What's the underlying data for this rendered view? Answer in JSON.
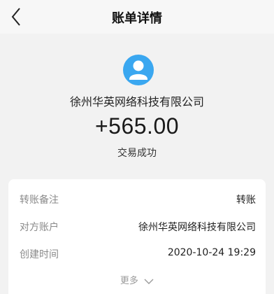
{
  "header": {
    "title": "账单详情"
  },
  "summary": {
    "avatar_icon": "user-avatar-icon",
    "payee_name": "徐州华英网络科技有限公司",
    "amount": "+565.00",
    "status": "交易成功"
  },
  "details": {
    "rows": [
      {
        "label": "转账备注",
        "value": "转账"
      },
      {
        "label": "对方账户",
        "value": "徐州华英网络科技有限公司"
      },
      {
        "label": "创建时间",
        "value": "2020-10-24 19:29"
      }
    ],
    "more_label": "更多"
  },
  "colors": {
    "avatar_bg": "#3aa7f0",
    "page_bg": "#f2f2f2",
    "card_bg": "#ffffff"
  }
}
